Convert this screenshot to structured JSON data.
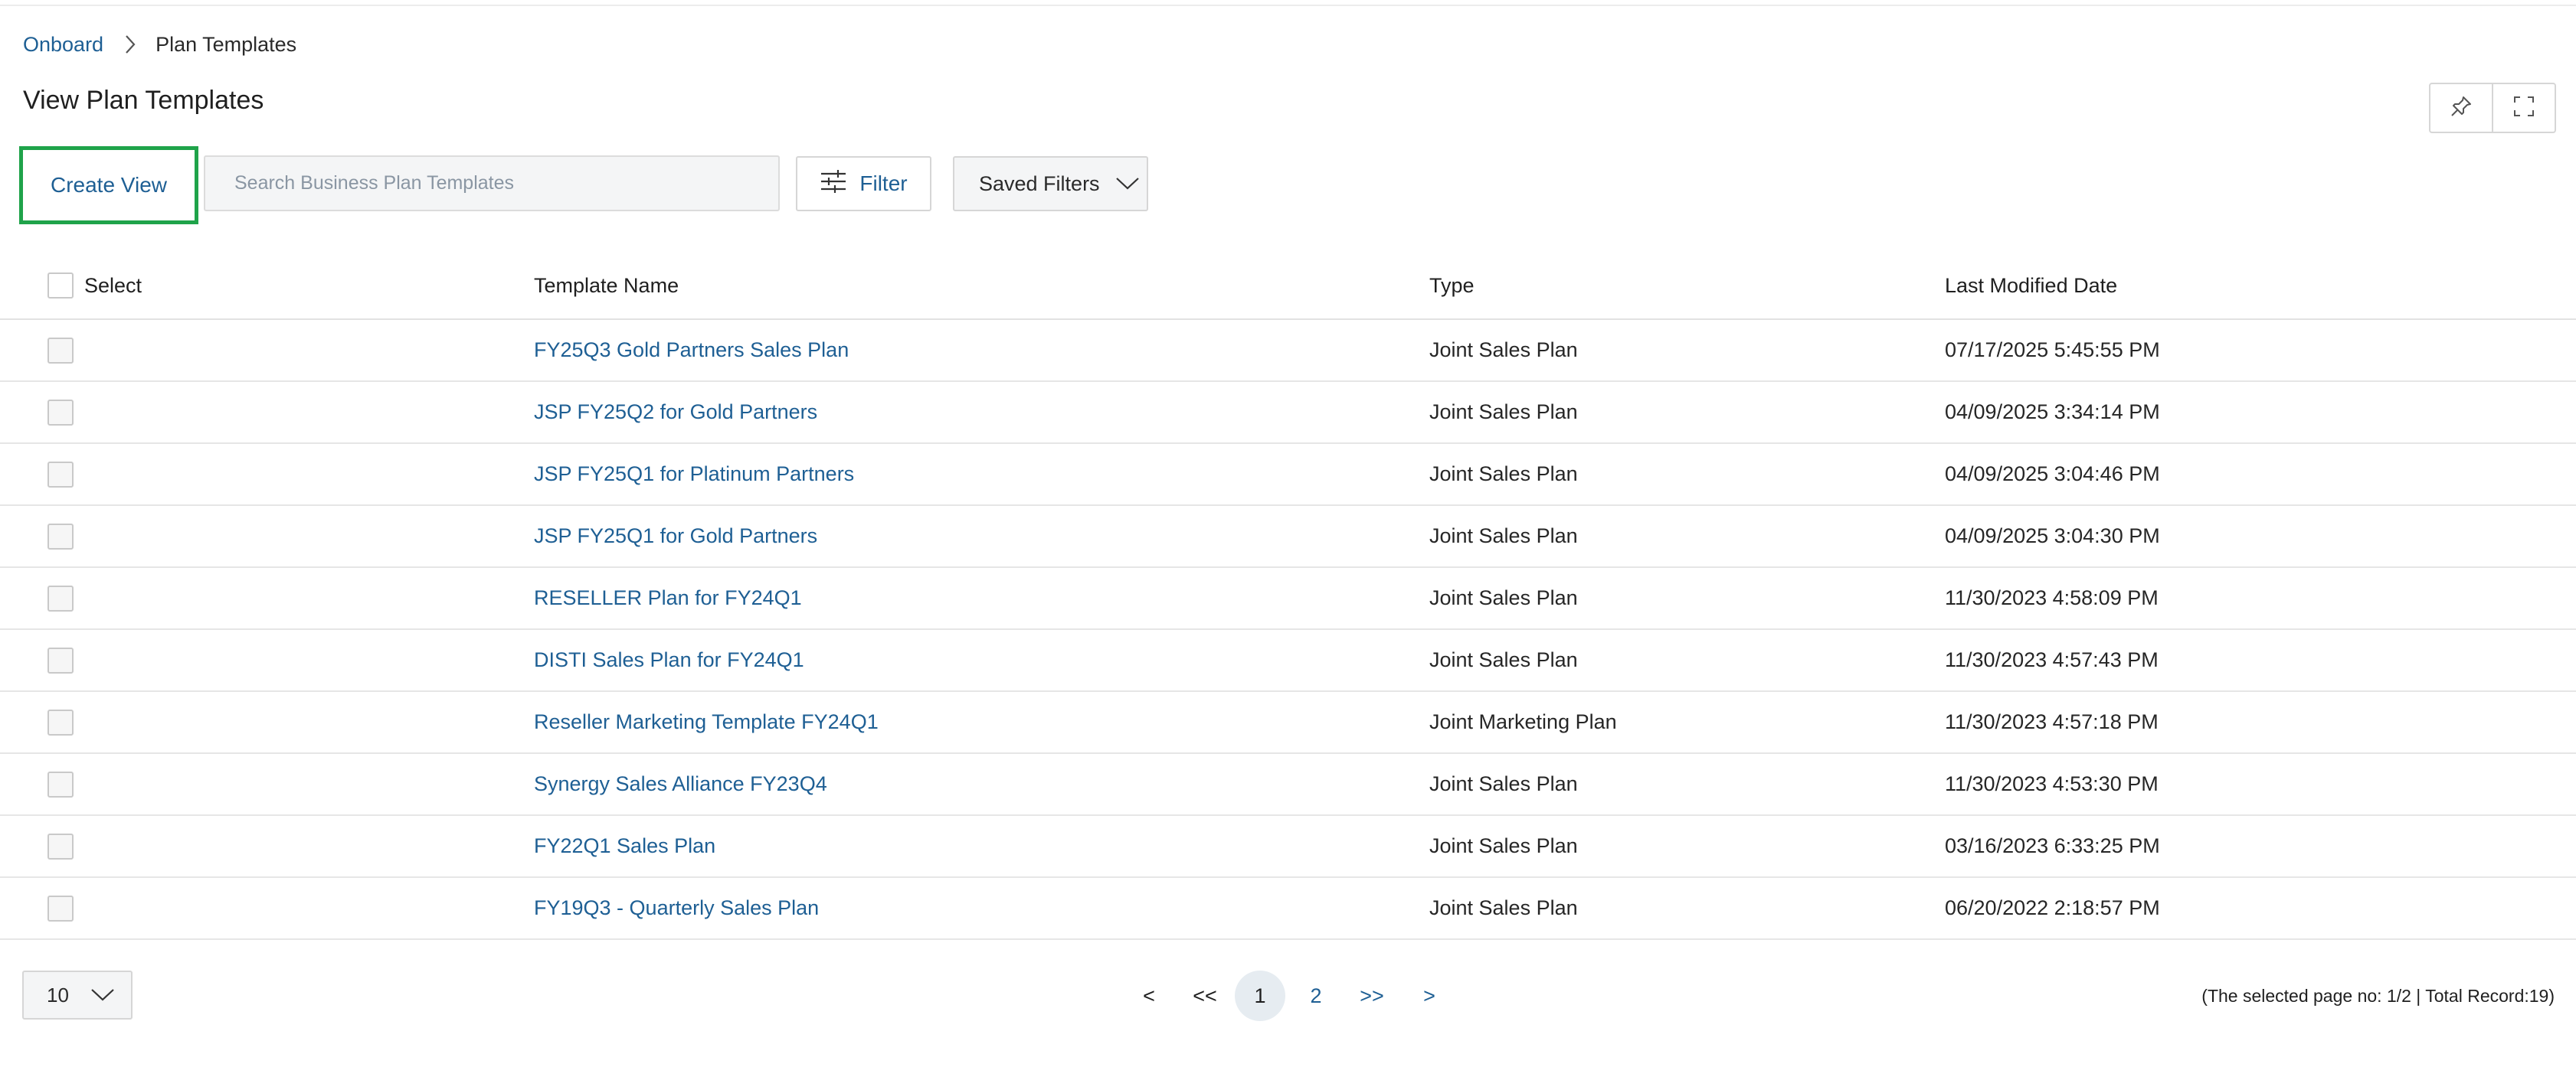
{
  "breadcrumb": {
    "root": "Onboard",
    "current": "Plan Templates"
  },
  "page": {
    "title": "View Plan Templates"
  },
  "toolbar": {
    "create_view": "Create View",
    "search_placeholder": "Search Business Plan Templates",
    "filter": "Filter",
    "saved_filters": "Saved Filters"
  },
  "table": {
    "columns": {
      "select": "Select",
      "name": "Template Name",
      "type": "Type",
      "date": "Last Modified Date"
    },
    "rows": [
      {
        "name": "FY25Q3 Gold Partners Sales Plan",
        "type": "Joint Sales Plan",
        "date": "07/17/2025 5:45:55 PM"
      },
      {
        "name": "JSP FY25Q2 for Gold Partners",
        "type": "Joint Sales Plan",
        "date": "04/09/2025 3:34:14 PM"
      },
      {
        "name": "JSP FY25Q1 for Platinum Partners",
        "type": "Joint Sales Plan",
        "date": "04/09/2025 3:04:46 PM"
      },
      {
        "name": "JSP FY25Q1 for Gold Partners",
        "type": "Joint Sales Plan",
        "date": "04/09/2025 3:04:30 PM"
      },
      {
        "name": "RESELLER Plan for FY24Q1",
        "type": "Joint Sales Plan",
        "date": "11/30/2023 4:58:09 PM"
      },
      {
        "name": "DISTI Sales Plan for FY24Q1",
        "type": "Joint Sales Plan",
        "date": "11/30/2023 4:57:43 PM"
      },
      {
        "name": "Reseller Marketing Template FY24Q1",
        "type": "Joint Marketing Plan",
        "date": "11/30/2023 4:57:18 PM"
      },
      {
        "name": "Synergy Sales Alliance FY23Q4",
        "type": "Joint Sales Plan",
        "date": "11/30/2023 4:53:30 PM"
      },
      {
        "name": "FY22Q1 Sales Plan",
        "type": "Joint Sales Plan",
        "date": "03/16/2023 6:33:25 PM"
      },
      {
        "name": "FY19Q3 - Quarterly Sales Plan",
        "type": "Joint Sales Plan",
        "date": "06/20/2022 2:18:57 PM"
      }
    ]
  },
  "pagination": {
    "page_size": "10",
    "prev": "<",
    "first": "<<",
    "page1": "1",
    "page2": "2",
    "last": ">>",
    "next": ">",
    "info": "(The selected page no: 1/2 | Total Record:19)"
  },
  "icons": {
    "breadcrumb_separator": "chevron-right-icon",
    "pin": "pin-icon",
    "expand": "expand-icon",
    "filter": "sliders-icon",
    "dropdown": "chevron-down-icon"
  },
  "colors": {
    "link": "#1e5f94",
    "highlight": "#1fa34a",
    "border": "#d6d6d6"
  }
}
